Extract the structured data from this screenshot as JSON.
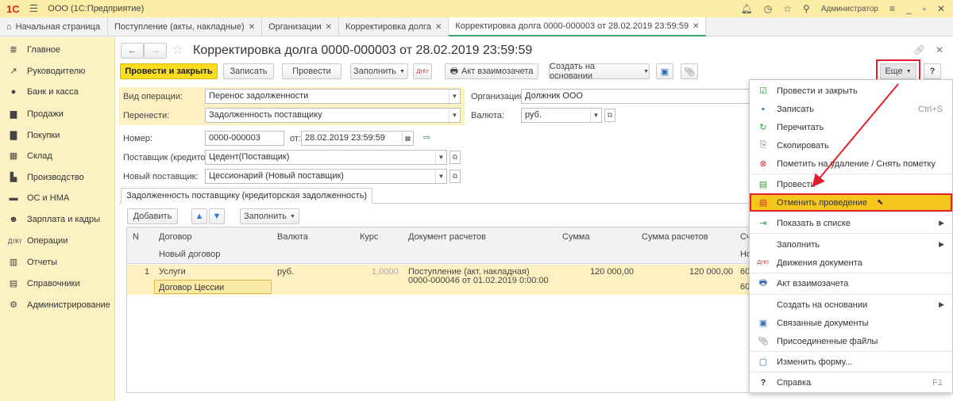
{
  "app": {
    "title": "ООО (1С:Предприятие)",
    "user": "Администратор"
  },
  "tabs": [
    {
      "label": "Начальная страница"
    },
    {
      "label": "Поступление (акты, накладные)"
    },
    {
      "label": "Организации"
    },
    {
      "label": "Корректировка долга"
    },
    {
      "label": "Корректировка долга 0000-000003 от 28.02.2019 23:59:59"
    }
  ],
  "sidebar": {
    "items": [
      {
        "label": "Главное",
        "icon": "menu-icon"
      },
      {
        "label": "Руководителю",
        "icon": "trend-icon"
      },
      {
        "label": "Банк и касса",
        "icon": "coin-icon"
      },
      {
        "label": "Продажи",
        "icon": "cart-icon"
      },
      {
        "label": "Покупки",
        "icon": "basket-icon"
      },
      {
        "label": "Склад",
        "icon": "warehouse-icon"
      },
      {
        "label": "Производство",
        "icon": "factory-icon"
      },
      {
        "label": "ОС и НМА",
        "icon": "car-icon"
      },
      {
        "label": "Зарплата и кадры",
        "icon": "person-icon"
      },
      {
        "label": "Операции",
        "icon": "dt-kt-icon"
      },
      {
        "label": "Отчеты",
        "icon": "chart-icon"
      },
      {
        "label": "Справочники",
        "icon": "book-icon"
      },
      {
        "label": "Администрирование",
        "icon": "gear-icon"
      }
    ]
  },
  "form": {
    "title": "Корректировка долга 0000-000003 от 28.02.2019 23:59:59",
    "toolbar": {
      "post_close": "Провести и закрыть",
      "save": "Записать",
      "post": "Провести",
      "fill": "Заполнить",
      "act": "Акт взаимозачета",
      "create_based": "Создать на основании",
      "more": "Еще",
      "help": "?"
    },
    "fields": {
      "op_type_label": "Вид операции:",
      "op_type": "Перенос задолженности",
      "transfer_label": "Перенести:",
      "transfer": "Задолженность поставщику",
      "org_label": "Организация:",
      "org": "Должник ООО",
      "currency_label": "Валюта:",
      "currency": "руб.",
      "number_label": "Номер:",
      "number": "0000-000003",
      "date_label": "от:",
      "date": "28.02.2019 23:59:59",
      "supplier_label": "Поставщик (кредитор):",
      "supplier": "Цедент(Поставщик)",
      "new_supplier_label": "Новый поставщик:",
      "new_supplier": "Цессионарий (Новый поставщик)"
    },
    "section_tab": "Задолженность поставщику (кредиторская задолженность)",
    "table_toolbar": {
      "add": "Добавить",
      "fill": "Заполнить"
    },
    "table": {
      "headers": [
        "N",
        "Договор",
        "Валюта",
        "Курс",
        "Документ расчетов",
        "Сумма",
        "Сумма расчетов",
        "Сч"
      ],
      "subheaders": {
        "contract": "Новый договор",
        "account": "Но"
      },
      "rows": [
        {
          "n": "1",
          "contract": "Услуги",
          "new_contract": "Договор Цессии",
          "currency": "руб.",
          "rate": "1,0000",
          "doc1": "Поступление (акт, накладная)",
          "doc2": "0000-000046 от 01.02.2019 0:00:00",
          "sum": "120 000,00",
          "sum_calc": "120 000,00",
          "acc1": "60",
          "acc2": "60"
        }
      ]
    }
  },
  "menu": {
    "items": [
      {
        "label": "Провести и закрыть",
        "icon": "post-close-icon"
      },
      {
        "label": "Записать",
        "shortcut": "Ctrl+S",
        "icon": "save-icon"
      },
      {
        "label": "Перечитать",
        "icon": "refresh-icon"
      },
      {
        "label": "Скопировать",
        "icon": "copy-icon"
      },
      {
        "label": "Пометить на удаление / Снять пометку",
        "icon": "delete-mark-icon"
      },
      {
        "label": "Провести",
        "icon": "post-icon"
      },
      {
        "label": "Отменить проведение",
        "icon": "unpost-icon"
      },
      {
        "label": "Показать в списке",
        "icon": "show-list-icon"
      },
      {
        "label": "Заполнить"
      },
      {
        "label": "Движения документа",
        "icon": "dt-kt-icon"
      },
      {
        "label": "Акт взаимозачета",
        "icon": "print-icon"
      },
      {
        "label": "Создать на основании"
      },
      {
        "label": "Связанные документы",
        "icon": "related-icon"
      },
      {
        "label": "Присоединенные файлы",
        "icon": "paperclip-icon"
      },
      {
        "label": "Изменить форму...",
        "icon": "form-icon"
      },
      {
        "label": "Справка",
        "shortcut": "F1",
        "icon": "help-icon"
      }
    ]
  },
  "colors": {
    "accent_yellow": "#fadd1e",
    "highlight_red": "#e0202a",
    "menu_highlight": "#f6c61c"
  }
}
